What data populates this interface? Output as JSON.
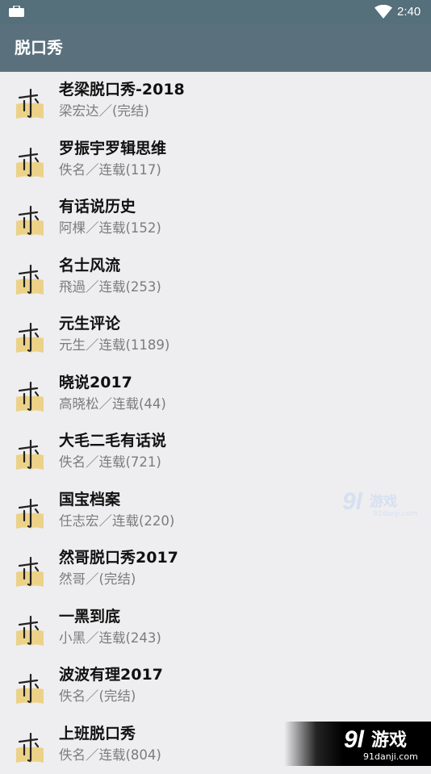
{
  "status_bar": {
    "time": "2:40"
  },
  "app_bar": {
    "title": "脱口秀"
  },
  "items": [
    {
      "name": "老梁脱口秀-2018",
      "meta": "梁宏达／(完结)"
    },
    {
      "name": "罗振宇罗辑思维",
      "meta": "佚名／连载(117)"
    },
    {
      "name": "有话说历史",
      "meta": "阿棵／连载(152)"
    },
    {
      "name": "名士风流",
      "meta": "飛過／连载(253)"
    },
    {
      "name": "元生评论",
      "meta": "元生／连载(1189)"
    },
    {
      "name": "晓说2017",
      "meta": "高晓松／连载(44)"
    },
    {
      "name": "大毛二毛有话说",
      "meta": "佚名／连载(721)"
    },
    {
      "name": "国宝档案",
      "meta": "任志宏／连载(220)"
    },
    {
      "name": "然哥脱口秀2017",
      "meta": "然哥／(完结)"
    },
    {
      "name": "一黑到底",
      "meta": "小黑／连载(243)"
    },
    {
      "name": "波波有理2017",
      "meta": "佚名／(完结)"
    },
    {
      "name": "上班脱口秀",
      "meta": "佚名／连载(804)"
    }
  ],
  "watermark": {
    "logo_text": "游戏",
    "site": "91danji.com"
  },
  "colors": {
    "status_bar": "#556f7b",
    "app_bar": "#5a717d",
    "background": "#eeeef0",
    "icon_book": "#ecd288"
  }
}
